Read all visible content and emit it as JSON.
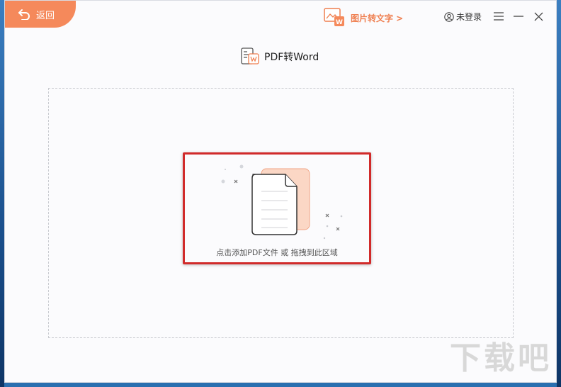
{
  "topbar": {
    "back_label": "返回",
    "image_to_text_label": "图片转文字 >",
    "login_label": "未登录"
  },
  "main": {
    "title": "PDF转Word",
    "drop_hint": "点击添加PDF文件 或 拖拽到此区域"
  },
  "watermark": "下载吧",
  "colors": {
    "accent": "#f5895b",
    "accent_text": "#ef7e4f",
    "highlight": "#d12a2a",
    "file_back": "#fbd7c5"
  }
}
